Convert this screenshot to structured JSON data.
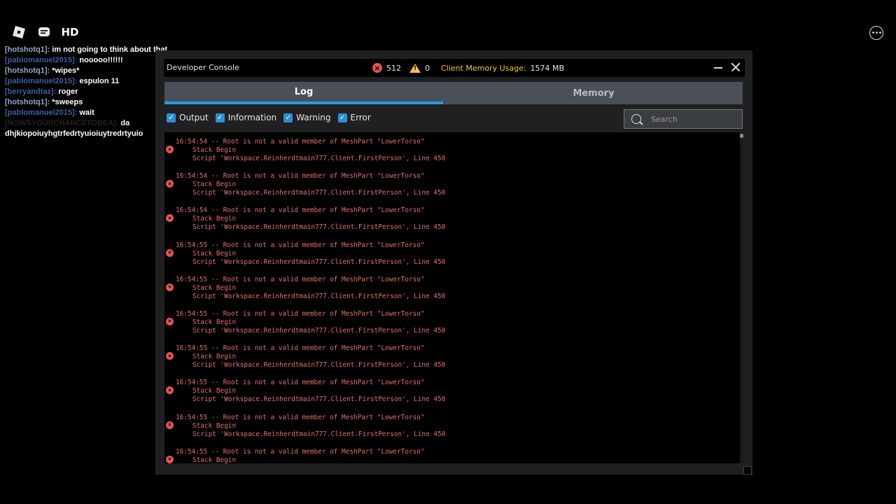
{
  "topbar": {
    "roblox_icon": "roblox-logo-icon",
    "chat_icon": "chat-icon",
    "hd_label": "HD",
    "more_icon": "more-icon"
  },
  "chat": [
    {
      "user": "[hotshotq1]:",
      "text": "im not going to think about that",
      "style": "plain"
    },
    {
      "user": "[pablomanuel2015]:",
      "text": "nooooo!!!!!!",
      "style": "blue"
    },
    {
      "user": "[hotshotq1]:",
      "text": "*wipes*",
      "style": "plain"
    },
    {
      "user": "[pablomanuel2015]:",
      "text": "espulon 11",
      "style": "blue"
    },
    {
      "user": "[berryandtaz]:",
      "text": "roger",
      "style": "blue"
    },
    {
      "user": "[hotshotq1]:",
      "text": "*sweeps",
      "style": "plain"
    },
    {
      "user": "[pablomanuel2015]:",
      "text": "wait",
      "style": "blue"
    },
    {
      "user": "[NOWSYOURCHANCETOBEA]:",
      "text": "da",
      "style": "faded"
    },
    {
      "user": "",
      "text": "dhjkiopoiuyhgtrfedrtyuioiuytredrtyuio",
      "style": "plain"
    }
  ],
  "console": {
    "title": "Developer Console",
    "error_count": "512",
    "warning_count": "0",
    "memory_label": "Client Memory Usage:",
    "memory_value": "1574 MB",
    "tabs": {
      "log": "Log",
      "memory": "Memory"
    },
    "filters": {
      "output": "Output",
      "information": "Information",
      "warning": "Warning",
      "error": "Error"
    },
    "search_placeholder": "Search",
    "colors": {
      "accent": "#1f9ee8",
      "error": "#e25555",
      "warning": "#f2c440"
    },
    "entries": [
      {
        "line1": "16:54:54 -- Root is not a valid member of MeshPart \"LowerTorso\"",
        "line2": "Stack Begin",
        "line3": "Script 'Workspace.Reinherdtmain777.Client.FirstPerson', Line 450"
      },
      {
        "line1": "16:54:54 -- Root is not a valid member of MeshPart \"LowerTorso\"",
        "line2": "Stack Begin",
        "line3": "Script 'Workspace.Reinherdtmain777.Client.FirstPerson', Line 450"
      },
      {
        "line1": "16:54:54 -- Root is not a valid member of MeshPart \"LowerTorso\"",
        "line2": "Stack Begin",
        "line3": "Script 'Workspace.Reinherdtmain777.Client.FirstPerson', Line 450"
      },
      {
        "line1": "16:54:55 -- Root is not a valid member of MeshPart \"LowerTorso\"",
        "line2": "Stack Begin",
        "line3": "Script 'Workspace.Reinherdtmain777.Client.FirstPerson', Line 450"
      },
      {
        "line1": "16:54:55 -- Root is not a valid member of MeshPart \"LowerTorso\"",
        "line2": "Stack Begin",
        "line3": "Script 'Workspace.Reinherdtmain777.Client.FirstPerson', Line 450"
      },
      {
        "line1": "16:54:55 -- Root is not a valid member of MeshPart \"LowerTorso\"",
        "line2": "Stack Begin",
        "line3": "Script 'Workspace.Reinherdtmain777.Client.FirstPerson', Line 450"
      },
      {
        "line1": "16:54:55 -- Root is not a valid member of MeshPart \"LowerTorso\"",
        "line2": "Stack Begin",
        "line3": "Script 'Workspace.Reinherdtmain777.Client.FirstPerson', Line 450"
      },
      {
        "line1": "16:54:55 -- Root is not a valid member of MeshPart \"LowerTorso\"",
        "line2": "Stack Begin",
        "line3": "Script 'Workspace.Reinherdtmain777.Client.FirstPerson', Line 450"
      },
      {
        "line1": "16:54:55 -- Root is not a valid member of MeshPart \"LowerTorso\"",
        "line2": "Stack Begin",
        "line3": "Script 'Workspace.Reinherdtmain777.Client.FirstPerson', Line 450"
      },
      {
        "line1": "16:54:55 -- Root is not a valid member of MeshPart \"LowerTorso\"",
        "line2": "Stack Begin",
        "line3": ""
      }
    ]
  }
}
